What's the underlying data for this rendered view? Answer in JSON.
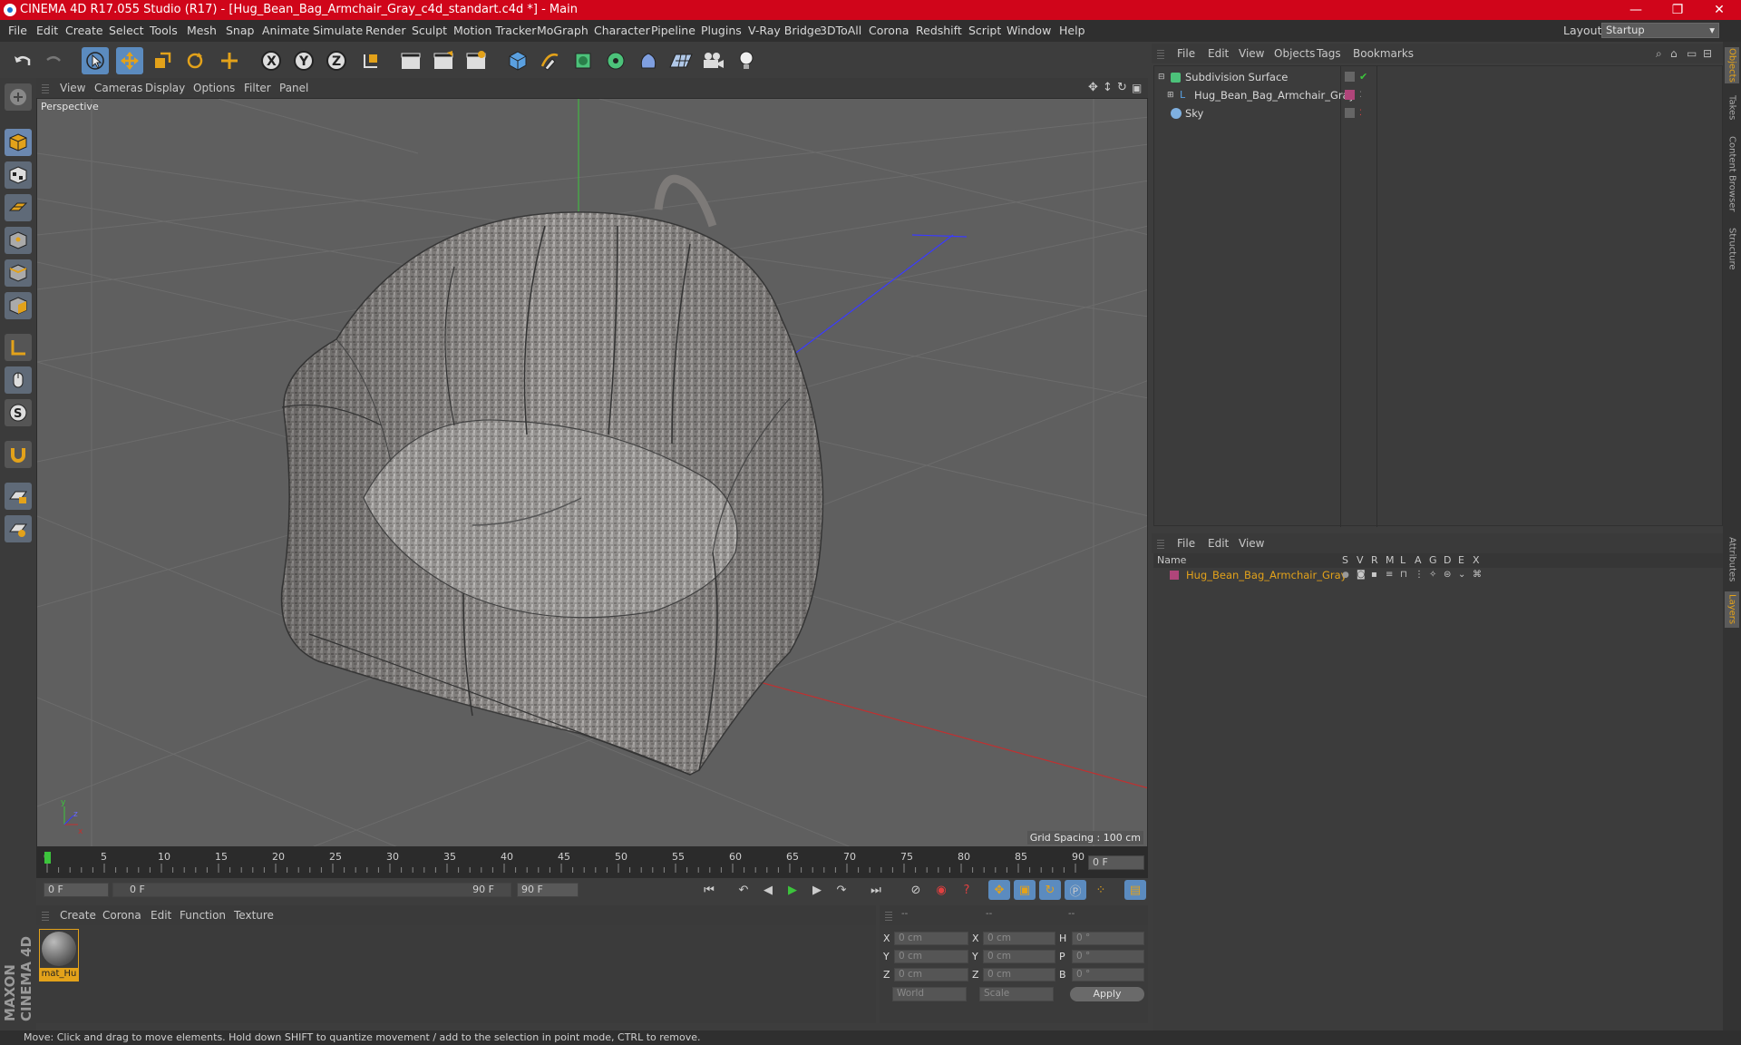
{
  "window": {
    "title": "CINEMA 4D R17.055 Studio (R17) - [Hug_Bean_Bag_Armchair_Gray_c4d_standart.c4d *] - Main",
    "min": "—",
    "max": "❐",
    "close": "✕"
  },
  "menu": [
    "File",
    "Edit",
    "Create",
    "Select",
    "Tools",
    "Mesh",
    "Snap",
    "Animate",
    "Simulate",
    "Render",
    "Sculpt",
    "Motion Tracker",
    "MoGraph",
    "Character",
    "Pipeline",
    "Plugins",
    "V-Ray Bridge",
    "3DToAll",
    "Corona",
    "Redshift",
    "Script",
    "Window",
    "Help"
  ],
  "layout": {
    "label": "Layout:",
    "value": "Startup"
  },
  "viewport": {
    "menu": [
      "View",
      "Cameras",
      "Display",
      "Options",
      "Filter",
      "Panel"
    ],
    "label": "Perspective",
    "grid_spacing": "Grid Spacing : 100 cm"
  },
  "timeline": {
    "ticks": [
      "0",
      "5",
      "10",
      "15",
      "20",
      "25",
      "30",
      "35",
      "40",
      "45",
      "50",
      "55",
      "60",
      "65",
      "70",
      "75",
      "80",
      "85",
      "90"
    ],
    "current_frame": "0 F",
    "start": "0 F",
    "range_start": "0 F",
    "range_end": "90 F",
    "end": "90 F"
  },
  "material_manager": {
    "menu": [
      "Create",
      "Corona",
      "Edit",
      "Function",
      "Texture"
    ],
    "material_name": "mat_Hu"
  },
  "coordinates": {
    "headers": [
      "--",
      "--",
      "--"
    ],
    "rows": [
      {
        "l1": "X",
        "v1": "0 cm",
        "l2": "X",
        "v2": "0 cm",
        "l3": "H",
        "v3": "0 °"
      },
      {
        "l1": "Y",
        "v1": "0 cm",
        "l2": "Y",
        "v2": "0 cm",
        "l3": "P",
        "v3": "0 °"
      },
      {
        "l1": "Z",
        "v1": "0 cm",
        "l2": "Z",
        "v2": "0 cm",
        "l3": "B",
        "v3": "0 °"
      }
    ],
    "mode1": "World",
    "mode2": "Scale",
    "apply": "Apply"
  },
  "object_manager": {
    "menu": [
      "File",
      "Edit",
      "View",
      "Objects",
      "Tags",
      "Bookmarks"
    ],
    "objects": [
      "Subdivision Surface",
      "Hug_Bean_Bag_Armchair_Gray",
      "Sky"
    ]
  },
  "layer_manager": {
    "menu": [
      "File",
      "Edit",
      "View"
    ],
    "columns": [
      "Name",
      "S",
      "V",
      "R",
      "M",
      "L",
      "A",
      "G",
      "D",
      "E",
      "X"
    ],
    "layer_name": "Hug_Bean_Bag_Armchair_Gray"
  },
  "side_tabs": [
    "Objects",
    "Takes",
    "Content Browser",
    "Structure",
    "Attributes",
    "Layers"
  ],
  "brand": "MAXON CINEMA 4D",
  "status": "Move: Click and drag to move elements. Hold down SHIFT to quantize movement / add to the selection in point mode, CTRL to remove.",
  "colors": {
    "titlebar": "#d0051a",
    "accent": "#e3a21a",
    "selection": "#5b8bbf",
    "layer_color": "#b0457a"
  }
}
